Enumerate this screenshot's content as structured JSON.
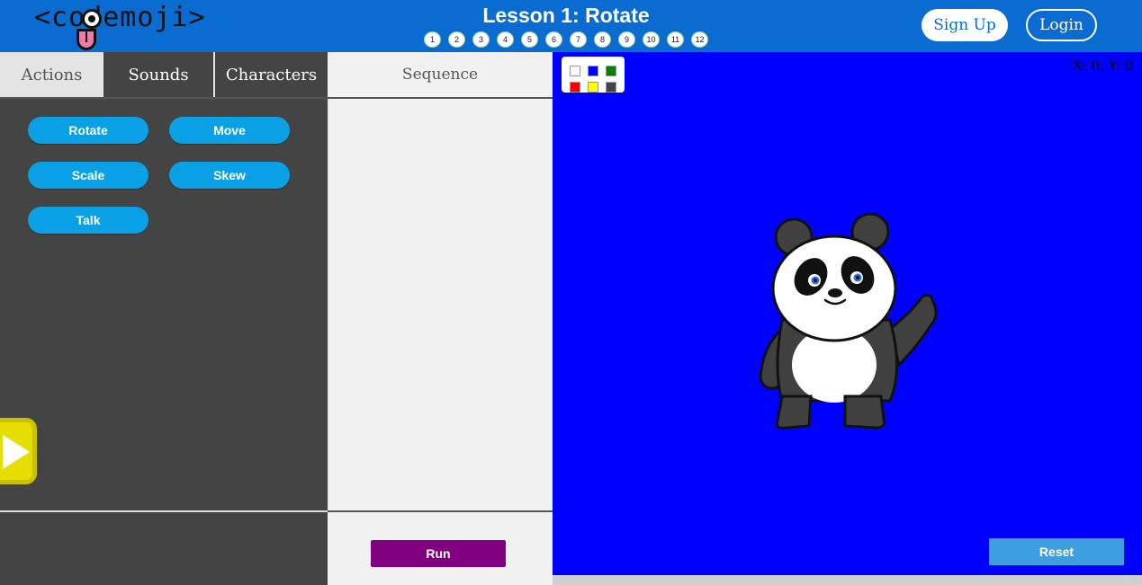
{
  "header": {
    "logo_text": "<codemoji>",
    "lesson_title": "Lesson 1: Rotate",
    "lesson_numbers": [
      "1",
      "2",
      "3",
      "4",
      "5",
      "6",
      "7",
      "8",
      "9",
      "10",
      "11",
      "12"
    ],
    "signup_label": "Sign Up",
    "login_label": "Login"
  },
  "tabs": {
    "actions": "Actions",
    "sounds": "Sounds",
    "characters": "Characters",
    "active": "Actions"
  },
  "sequence": {
    "title": "Sequence",
    "run_label": "Run"
  },
  "actions": {
    "rotate": "Rotate",
    "move": "Move",
    "scale": "Scale",
    "skew": "Skew",
    "talk": "Talk"
  },
  "stage": {
    "background_color": "#0000ff",
    "coords_text": "X: 0, Y: 0",
    "reset_label": "Reset",
    "palette_colors": [
      "#ffffff",
      "#0000ff",
      "#008000",
      "#ff0000",
      "#ffff00",
      "#444444"
    ],
    "character": "panda"
  },
  "colors": {
    "header_bg": "#0a6bd0",
    "action_button": "#0aa0e6",
    "run_button": "#800080",
    "reset_button": "#3d9ee0",
    "play_tab": "#e6de00"
  }
}
